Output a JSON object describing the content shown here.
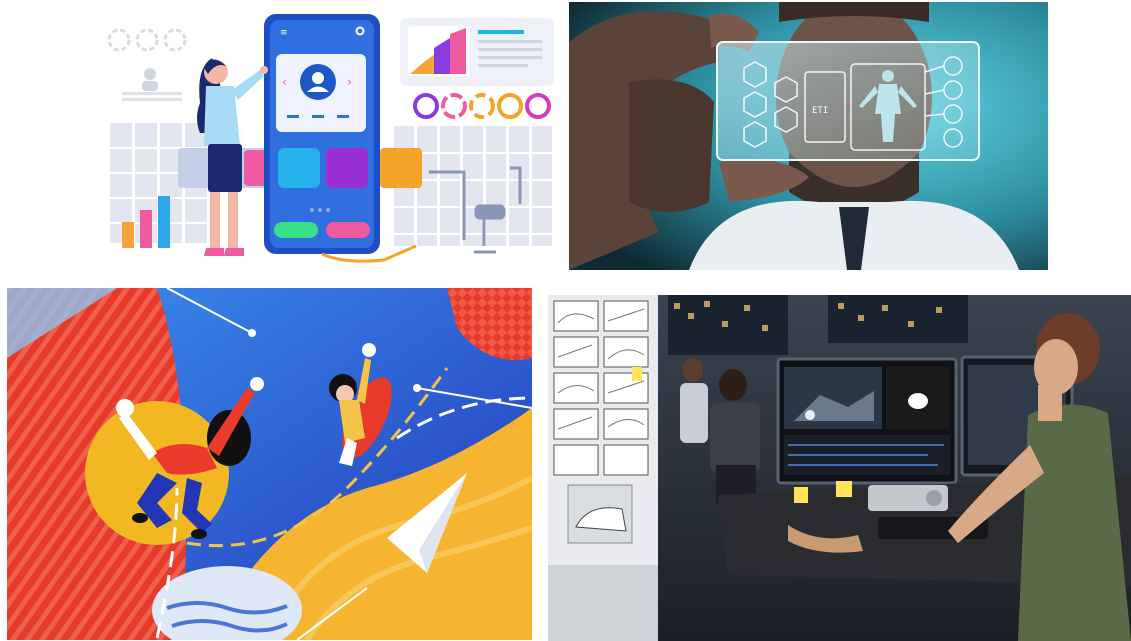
{
  "collage": {
    "panels": [
      {
        "name": "mobile-app-ui-illustration",
        "bg": "#ffffff",
        "accent": "#2f6fe0"
      },
      {
        "name": "transparent-medical-display-photo",
        "bg": "#1a3a44",
        "accent": "#bfe9f2"
      },
      {
        "name": "abstract-flight-illustration",
        "bg": "#e63a2a",
        "accent": "#2f58d8"
      },
      {
        "name": "video-editing-studio-photo",
        "bg": "#2a2f36",
        "accent": "#ffe45a"
      }
    ],
    "overlay_text": {
      "hologram_label": "ETI"
    }
  }
}
